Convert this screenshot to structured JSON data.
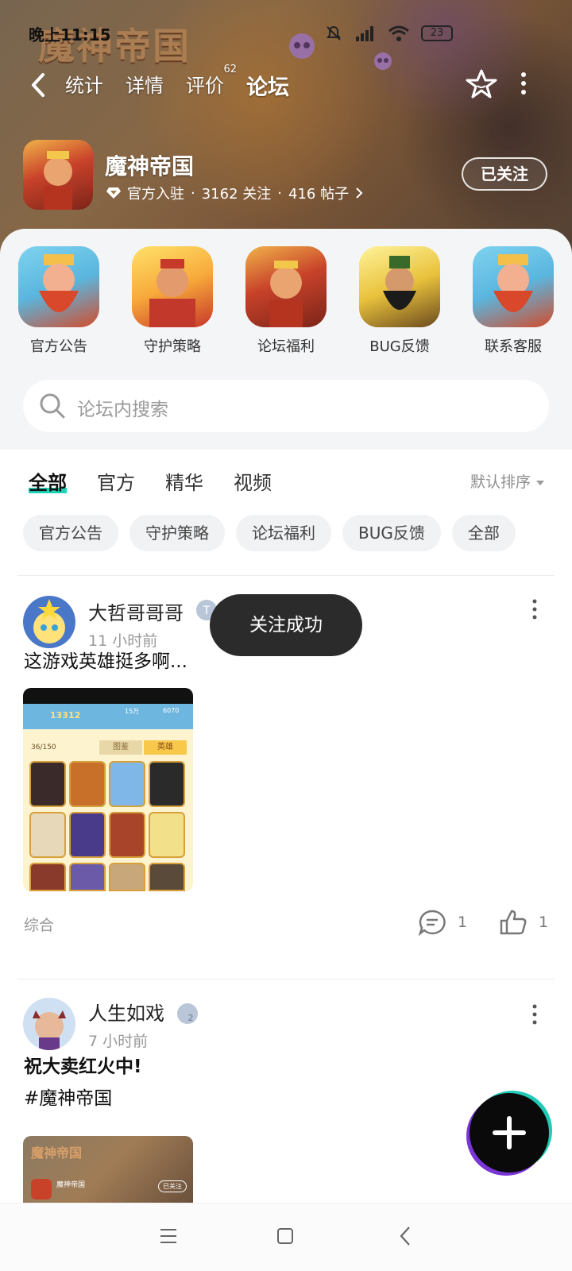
{
  "status_bar": {
    "time": "晚上11:15",
    "battery": "23"
  },
  "banner": {
    "logo_text": "魔神帝国"
  },
  "nav": {
    "tabs": [
      {
        "label": "统计"
      },
      {
        "label": "详情"
      },
      {
        "label": "评价",
        "badge": "62"
      },
      {
        "label": "论坛",
        "active": true
      }
    ]
  },
  "game": {
    "title": "魔神帝国",
    "official": "官方入驻",
    "follows": "3162 关注",
    "posts": "416 帖子",
    "follow_button": "已关注"
  },
  "categories": [
    {
      "label": "官方公告"
    },
    {
      "label": "守护策略"
    },
    {
      "label": "论坛福利"
    },
    {
      "label": "BUG反馈"
    },
    {
      "label": "联系客服"
    }
  ],
  "search": {
    "placeholder": "论坛内搜索"
  },
  "feed_tabs": [
    {
      "label": "全部",
      "active": true
    },
    {
      "label": "官方"
    },
    {
      "label": "精华"
    },
    {
      "label": "视频"
    }
  ],
  "sort_label": "默认排序",
  "chips": [
    {
      "label": "官方公告"
    },
    {
      "label": "守护策略"
    },
    {
      "label": "论坛福利"
    },
    {
      "label": "BUG反馈"
    },
    {
      "label": "全部"
    }
  ],
  "posts": [
    {
      "author": "大哲哥哥哥",
      "time": "11 小时前",
      "text": "这游戏英雄挺多啊...",
      "tag": "综合",
      "comments": "1",
      "likes": "1",
      "image_texts": {
        "score": "13312",
        "count": "36/150",
        "tab_left": "图鉴",
        "tab_right": "英雄",
        "coins": "15万",
        "gems": "6070"
      }
    },
    {
      "author": "人生如戏",
      "level": "2",
      "time": "7 小时前",
      "text_line1": "祝大卖红火中!",
      "text_line2": "#魔神帝国",
      "image_texts": {
        "logo": "魔神帝国",
        "name": "魔神帝国",
        "follow": "已关注"
      }
    }
  ],
  "toast": "关注成功",
  "colors": {
    "accent": "#1ed4b6",
    "toast_bg": "#2b2b2b"
  }
}
